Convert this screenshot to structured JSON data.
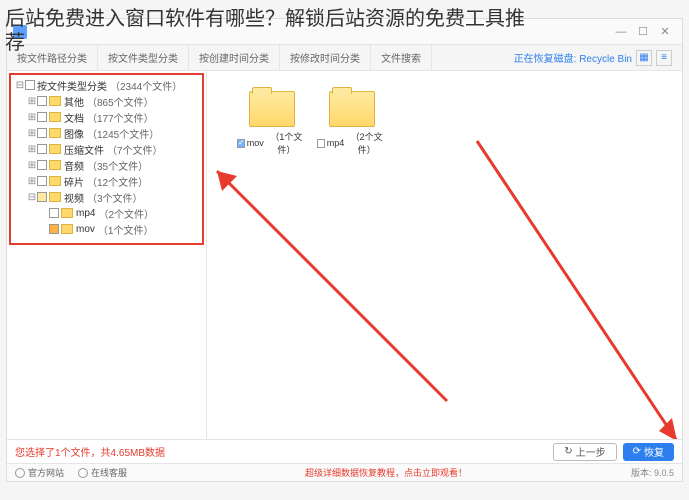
{
  "overlay": {
    "line1": "后站免费进入窗口软件有哪些？解锁后站资源的免费工具推",
    "line2": "荐"
  },
  "titlebar": {
    "title": ""
  },
  "tabs": {
    "items": [
      {
        "label": "按文件路径分类"
      },
      {
        "label": "按文件类型分类"
      },
      {
        "label": "按创建时间分类"
      },
      {
        "label": "按修改时间分类"
      },
      {
        "label": "文件搜索"
      }
    ],
    "status": "正在恢复磁盘: Recycle Bin"
  },
  "tree": {
    "root_label": "按文件类型分类",
    "root_count": "（2344个文件）",
    "items": [
      {
        "label": "其他",
        "count": "（865个文件）"
      },
      {
        "label": "文档",
        "count": "（177个文件）"
      },
      {
        "label": "图像",
        "count": "（1245个文件）"
      },
      {
        "label": "压缩文件",
        "count": "（7个文件）"
      },
      {
        "label": "音频",
        "count": "（35个文件）"
      },
      {
        "label": "碎片",
        "count": "（12个文件）"
      },
      {
        "label": "视频",
        "count": "（3个文件）"
      }
    ],
    "sub": [
      {
        "label": "mp4",
        "count": "（2个文件）"
      },
      {
        "label": "mov",
        "count": "（1个文件）"
      }
    ]
  },
  "content": {
    "tiles": [
      {
        "name": "mov",
        "count": "（1个文件）",
        "checked": true
      },
      {
        "name": "mp4",
        "count": "（2个文件）",
        "checked": false
      }
    ]
  },
  "footer": {
    "status": "您选择了1个文件，共4.65MB数据",
    "prev": "上一步",
    "restore": "恢复"
  },
  "bottombar": {
    "site": "官方网站",
    "support": "在线客服",
    "msg": "超级详细数据恢复教程，点击立即观看！",
    "version": "版本: 9.0.5"
  }
}
